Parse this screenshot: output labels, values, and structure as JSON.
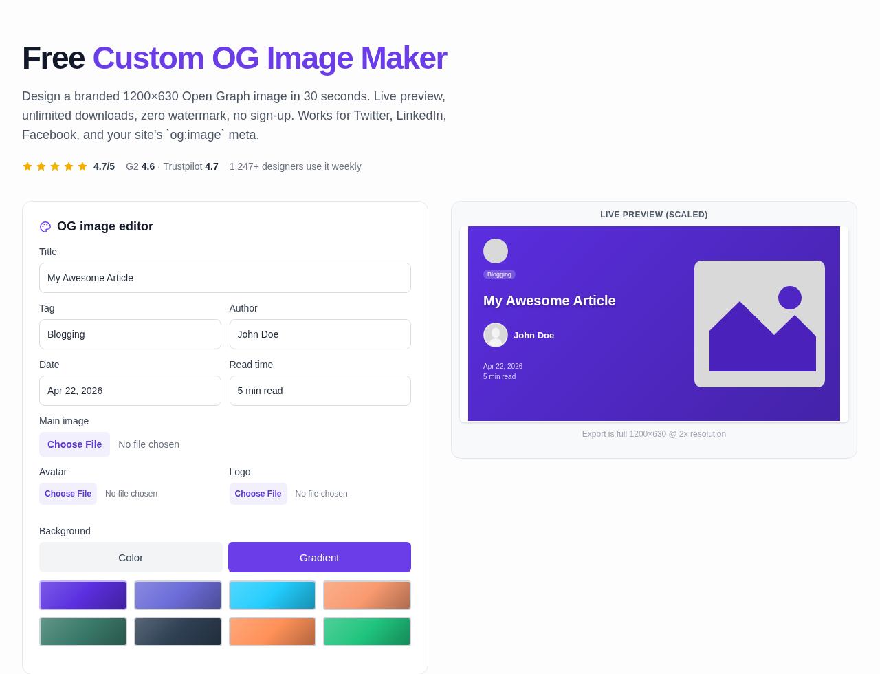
{
  "header": {
    "title_lead": "Free",
    "title_highlight": "Custom OG Image Maker",
    "description": "Design a branded 1200×630 Open Graph image in 30 seconds. Live preview, unlimited downloads, zero watermark, no sign-up. Works for Twitter, LinkedIn, Facebook, and your site's `og:image` meta.",
    "rating": {
      "stars": 5,
      "score": "4.7/5",
      "sources": "G2 **4.6** · Trustpilot **4.7**",
      "users": "1,247+ designers use it weekly"
    }
  },
  "editor": {
    "heading": "OG image editor",
    "title_field": {
      "label": "Title",
      "value": "My Awesome Article"
    },
    "fields": [
      {
        "label": "Tag",
        "value": "Blogging"
      },
      {
        "label": "Author",
        "value": "John Doe"
      },
      {
        "label": "Date",
        "value": "Apr 22, 2026"
      },
      {
        "label": "Read time",
        "value": "5 min read"
      }
    ],
    "main_upload": {
      "label": "Main image",
      "button": "Choose File",
      "status": "No file chosen"
    },
    "uploads": [
      {
        "label": "Avatar",
        "button": "Choose File",
        "status": "No file chosen"
      },
      {
        "label": "Logo",
        "button": "Choose File",
        "status": "No file chosen"
      }
    ],
    "background_label": "Background",
    "background_modes": [
      {
        "label": "Color",
        "selected": false
      },
      {
        "label": "Gradient",
        "selected": true
      }
    ],
    "swatches": [
      {
        "color": "#5b2ee0",
        "selected": true
      },
      {
        "color": "#6c6cd8",
        "selected": false
      },
      {
        "color": "#22cdfd",
        "selected": false
      },
      {
        "color": "#f99a70",
        "selected": false
      },
      {
        "color": "#3a7a6a",
        "selected": false
      },
      {
        "color": "#2f4054",
        "selected": false
      },
      {
        "color": "#ff9158",
        "selected": false
      },
      {
        "color": "#1fc47e",
        "selected": false
      }
    ]
  },
  "preview": {
    "heading": "LIVE PREVIEW (SCALED)",
    "tag": "Blogging",
    "title": "My Awesome Article",
    "author": "John Doe",
    "date": "Apr 22, 2026",
    "read_time": "5 min read",
    "note": "Export is full 1200×630 @ 2x resolution"
  }
}
